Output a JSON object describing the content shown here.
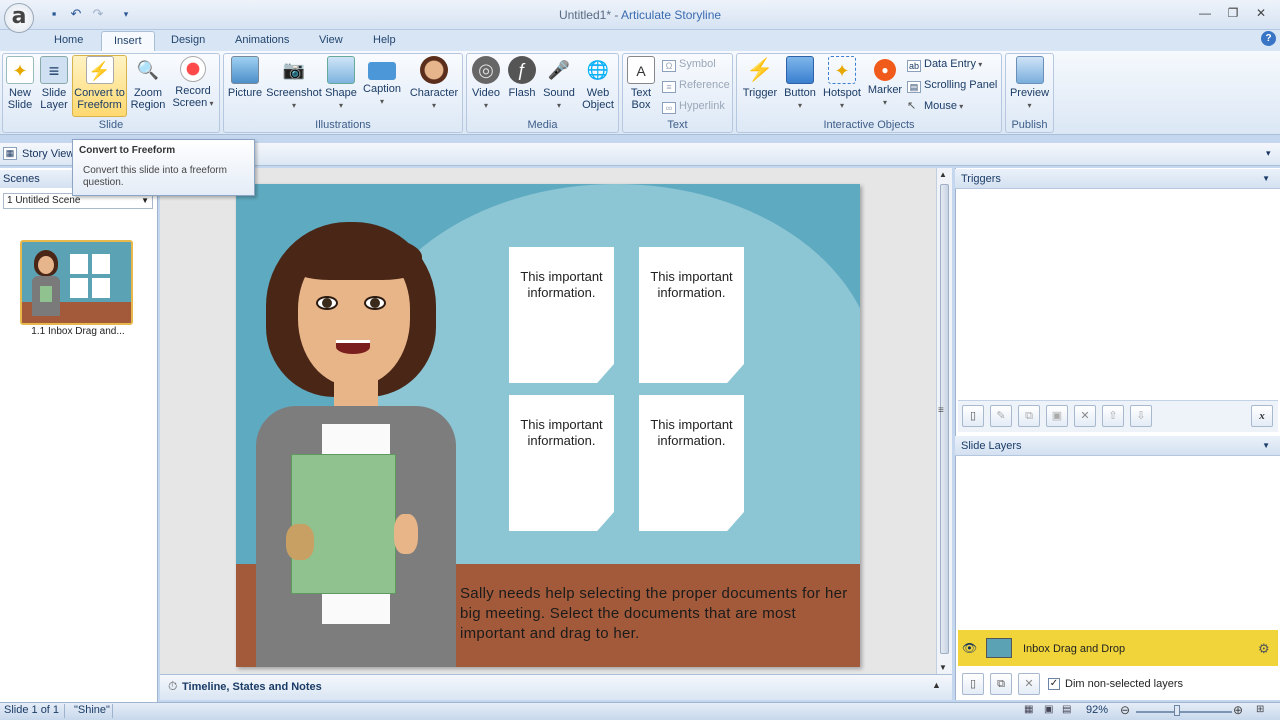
{
  "window": {
    "doc_title": "Untitled1*",
    "separator": " - ",
    "app_name": "Articulate Storyline"
  },
  "tabs": [
    "Home",
    "Insert",
    "Design",
    "Animations",
    "View",
    "Help"
  ],
  "active_tab": "Insert",
  "ribbon": {
    "slide_group": {
      "label": "Slide",
      "buttons": [
        "New Slide",
        "Slide Layer",
        "Convert to Freeform",
        "Zoom Region",
        "Record Screen"
      ]
    },
    "illustrations_group": {
      "label": "Illustrations",
      "buttons": [
        "Picture",
        "Screenshot",
        "Shape",
        "Caption",
        "Character"
      ]
    },
    "media_group": {
      "label": "Media",
      "buttons": [
        "Video",
        "Flash",
        "Sound",
        "Web Object"
      ]
    },
    "text_group": {
      "label": "Text",
      "text_box": "Text Box",
      "symbol": "Symbol",
      "reference": "Reference",
      "hyperlink": "Hyperlink"
    },
    "interactive_group": {
      "label": "Interactive Objects",
      "buttons": [
        "Trigger",
        "Button",
        "Hotspot",
        "Marker"
      ],
      "data_entry": "Data Entry",
      "scrolling_panel": "Scrolling Panel",
      "mouse": "Mouse"
    },
    "publish_group": {
      "label": "Publish",
      "preview": "Preview"
    }
  },
  "viewbar": {
    "story_view": "Story View"
  },
  "tooltip": {
    "title": "Convert to Freeform",
    "description": "Convert this slide into a freeform question."
  },
  "scenes": {
    "header": "Scenes",
    "selected": "1 Untitled Scene",
    "thumb_label": "1.1 Inbox Drag and..."
  },
  "slide": {
    "cards": [
      "This important information.",
      "This important information.",
      "This important information.",
      "This important information."
    ],
    "caption": "Sally needs help selecting the proper documents for her big meeting. Select the documents that are most important and drag to her."
  },
  "timeline": {
    "label": "Timeline, States and Notes"
  },
  "triggers": {
    "header": "Triggers"
  },
  "layers": {
    "header": "Slide Layers",
    "base_layer": "Inbox Drag and Drop",
    "dim_label": "Dim non-selected layers",
    "dim_checked": true
  },
  "status": {
    "slide_count": "Slide 1 of 1",
    "theme": "\"Shine\"",
    "zoom": "92%"
  },
  "colors": {
    "accent": "#3b6bb0",
    "slide_bg": "#5eaac0",
    "floor": "#a35a3a",
    "layer_highlight": "#f0d43a"
  }
}
